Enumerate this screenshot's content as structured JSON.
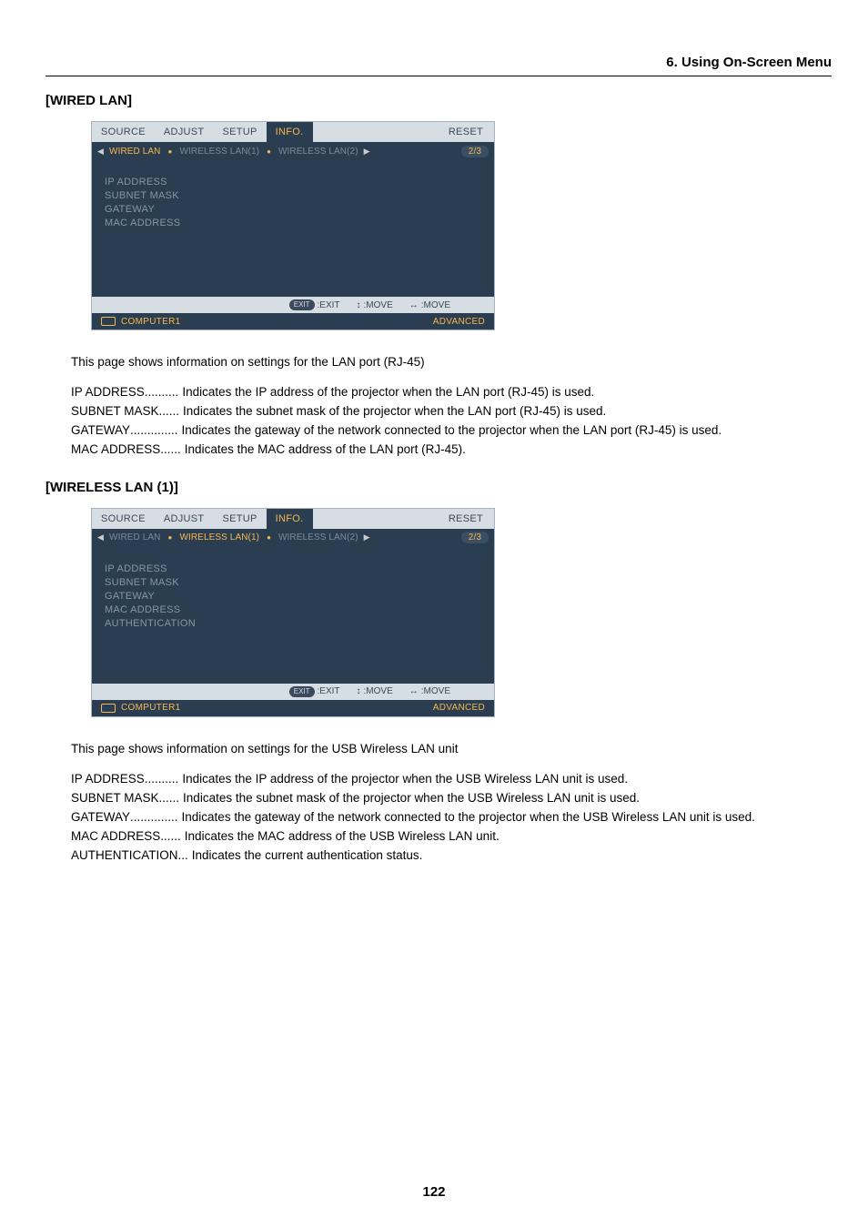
{
  "chapter": "6. Using On-Screen Menu",
  "pageNumber": "122",
  "section1": {
    "title": "[WIRED LAN]",
    "osd": {
      "top": {
        "source": "SOURCE",
        "adjust": "ADJUST",
        "setup": "SETUP",
        "info": "INFO.",
        "reset": "RESET"
      },
      "sub": {
        "wired": "WIRED LAN",
        "w1": "WIRELESS LAN(1)",
        "w2": "WIRELESS LAN(2)",
        "page": "2/3"
      },
      "body": [
        "IP ADDRESS",
        "SUBNET MASK",
        "GATEWAY",
        "MAC ADDRESS"
      ],
      "hints": {
        "exit": ":EXIT",
        "move1": ":MOVE",
        "move2": ":MOVE",
        "exitLabel": "EXIT"
      },
      "footer": {
        "src": "COMPUTER1",
        "adv": "ADVANCED"
      }
    },
    "desc": "This page shows information on settings for the LAN port (RJ-45)",
    "defs": [
      {
        "term": "IP ADDRESS",
        "dots": "..........",
        "value": "Indicates the IP address of the projector when the LAN port (RJ-45) is used."
      },
      {
        "term": "SUBNET MASK",
        "dots": "......",
        "value": "Indicates the subnet mask of the projector when the LAN port (RJ-45) is used."
      },
      {
        "term": "GATEWAY",
        "dots": "..............",
        "value": "Indicates the gateway of the network connected to the projector when the LAN port (RJ-45) is used."
      },
      {
        "term": "MAC ADDRESS",
        "dots": "......",
        "value": "Indicates the MAC address of the LAN port (RJ-45)."
      }
    ]
  },
  "section2": {
    "title": "[WIRELESS LAN (1)]",
    "osd": {
      "top": {
        "source": "SOURCE",
        "adjust": "ADJUST",
        "setup": "SETUP",
        "info": "INFO.",
        "reset": "RESET"
      },
      "sub": {
        "wired": "WIRED LAN",
        "w1": "WIRELESS LAN(1)",
        "w2": "WIRELESS LAN(2)",
        "page": "2/3"
      },
      "body": [
        "IP ADDRESS",
        "SUBNET MASK",
        "GATEWAY",
        "MAC ADDRESS",
        "AUTHENTICATION"
      ],
      "hints": {
        "exit": ":EXIT",
        "move1": ":MOVE",
        "move2": ":MOVE",
        "exitLabel": "EXIT"
      },
      "footer": {
        "src": "COMPUTER1",
        "adv": "ADVANCED"
      }
    },
    "desc": "This page shows information on settings for the USB Wireless LAN unit",
    "defs": [
      {
        "term": "IP ADDRESS",
        "dots": "..........",
        "value": "Indicates the IP address of the projector when the USB Wireless LAN unit is used."
      },
      {
        "term": "SUBNET MASK",
        "dots": "......",
        "value": "Indicates the subnet mask of the projector when the USB Wireless LAN unit is used."
      },
      {
        "term": "GATEWAY",
        "dots": "..............",
        "value": "Indicates the gateway of the network connected to the projector when the USB Wireless LAN unit is used."
      },
      {
        "term": "MAC ADDRESS",
        "dots": "......",
        "value": "Indicates the MAC address of the USB Wireless LAN unit."
      },
      {
        "term": "AUTHENTICATION",
        "dots": "...",
        "value": "Indicates the current authentication status."
      }
    ]
  }
}
